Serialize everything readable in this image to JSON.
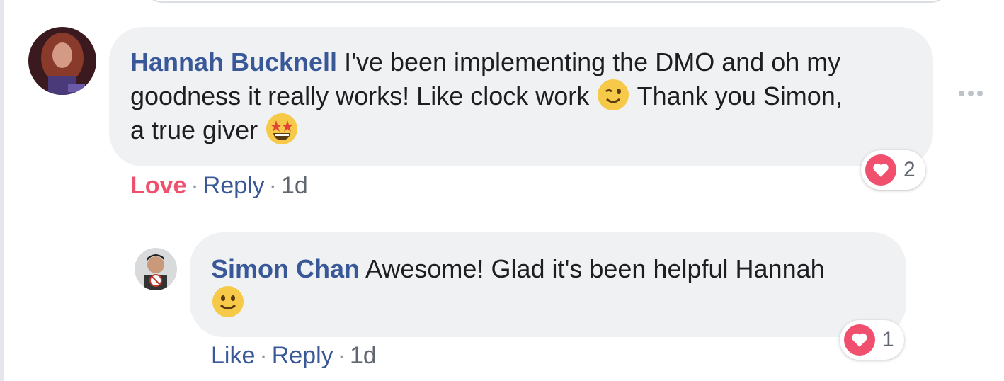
{
  "comment": {
    "author": "Hannah Bucknell",
    "text_line1": " I've been implementing the DMO and oh my",
    "text_line2": "goodness it really works! Like clock work",
    "text_line2b": " Thank you Simon,",
    "text_line3": "a true giver",
    "emoji_1": "winking-face-icon",
    "emoji_2": "star-struck-face-icon",
    "actions": {
      "reaction_label": "Love",
      "reply_label": "Reply",
      "time": "1d",
      "separator": "·"
    },
    "reactions": {
      "type": "heart-icon",
      "count": "2"
    }
  },
  "reply": {
    "author": "Simon Chan",
    "text_line1": " Awesome! Glad it's been helpful Hannah",
    "emoji": "smiling-face-icon",
    "actions": {
      "like_label": "Like",
      "reply_label": "Reply",
      "time": "1d",
      "separator": "·"
    },
    "reactions": {
      "type": "heart-icon",
      "count": "1"
    }
  },
  "colors": {
    "author": "#385898",
    "love": "#f0506e",
    "bubble": "#f0f1f3",
    "meta": "#606770"
  },
  "more_options_icon": "more-options-icon"
}
